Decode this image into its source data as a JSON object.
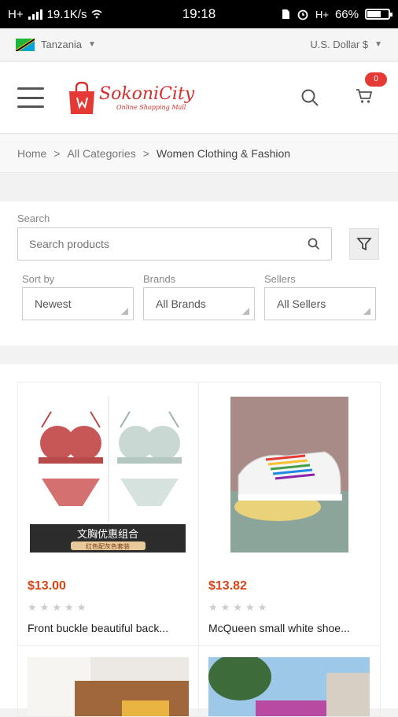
{
  "status_bar": {
    "network": "H+",
    "speed": "19.1K/s",
    "time": "19:18",
    "network2": "H+",
    "battery": "66%",
    "battery_level": 0.66
  },
  "top_bar": {
    "country": "Tanzania",
    "currency": "U.S. Dollar $"
  },
  "header": {
    "logo_name": "SokoniCity",
    "logo_tagline": "Online Shopping Mall",
    "cart_count": "0"
  },
  "breadcrumb": {
    "home": "Home",
    "sep1": ">",
    "all_categories": "All Categories",
    "sep2": ">",
    "current": "Women Clothing & Fashion"
  },
  "search": {
    "label": "Search",
    "placeholder": "Search products"
  },
  "filters": {
    "sort_label": "Sort by",
    "sort_value": "Newest",
    "brands_label": "Brands",
    "brands_value": "All Brands",
    "sellers_label": "Sellers",
    "sellers_value": "All Sellers"
  },
  "products": [
    {
      "price": "$13.00",
      "name": "Front buckle beautiful back...",
      "rating": 0,
      "image_caption": "文胸优惠组合",
      "image_subcaption": "红色配灰色套装"
    },
    {
      "price": "$13.82",
      "name": "McQueen small white shoe...",
      "rating": 0
    }
  ],
  "colors": {
    "brand_red": "#d32f2f",
    "price": "#d84315",
    "badge": "#e53935"
  }
}
